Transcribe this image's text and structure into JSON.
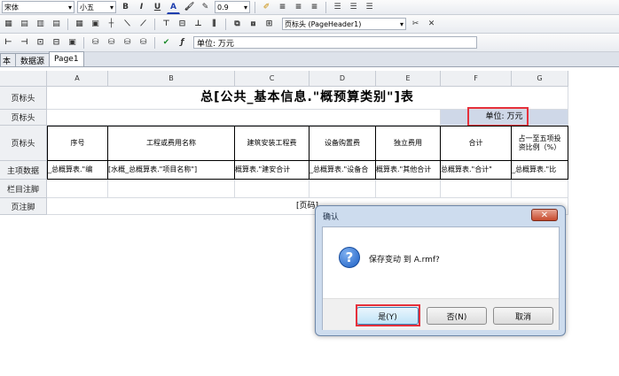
{
  "toolbar": {
    "font_name": "宋体",
    "font_size": "小五",
    "bold": "B",
    "italic": "I",
    "underline": "U",
    "line_width": "0.9",
    "section_select": "页标头 (PageHeader1)",
    "unit_label": "单位: 万元"
  },
  "tabs": [
    {
      "label": "本"
    },
    {
      "label": "数据源"
    },
    {
      "label": "Page1"
    }
  ],
  "columns": [
    "A",
    "B",
    "C",
    "D",
    "E",
    "F",
    "G"
  ],
  "row_labels": [
    "页标头",
    "页标头",
    "页标头",
    "主项数据",
    "栏目注脚",
    "页注脚"
  ],
  "report": {
    "title": "总[公共_基本信息.\"概预算类别\"]表",
    "unit": "单位: 万元",
    "headers": [
      "序号",
      "工程或费用名称",
      "建筑安装工程费",
      "设备购置费",
      "独立费用",
      "合计",
      "占一至五项投资比例（%）"
    ],
    "data_row": [
      "_总概算表.\"编",
      "[水概_总概算表.\"项目名称\"]",
      "概算表.\"建安合计",
      "_总概算表.\"设备合",
      "概算表.\"其他合计",
      "总概算表.\"合计\"",
      "_总概算表.\"比"
    ],
    "page_footer": "[页码]"
  },
  "dialog": {
    "title": "确认",
    "close_label": "✕",
    "message": "保存变动 到 A.rmf?",
    "yes_label": "是(Y)",
    "no_label": "否(N)",
    "cancel_label": "取消"
  }
}
